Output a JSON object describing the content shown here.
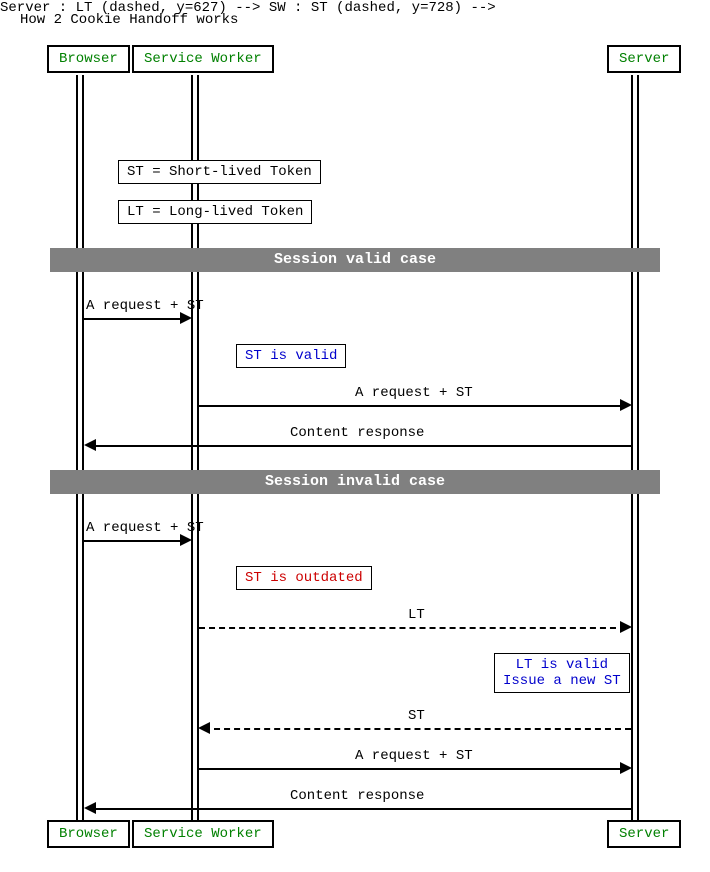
{
  "title": "How 2 Cookie Handoff works",
  "participants": {
    "browser": "Browser",
    "service_worker": "Service Worker",
    "server": "Server"
  },
  "notes": {
    "st_def": "ST = Short-lived Token",
    "lt_def": "LT = Long-lived Token",
    "st_valid": "ST is valid",
    "st_outdated": "ST is outdated",
    "lt_valid_l1": "LT is valid",
    "lt_valid_l2": "Issue a new ST"
  },
  "dividers": {
    "valid": "Session valid case",
    "invalid": "Session invalid case"
  },
  "messages": {
    "req_st": "A request + ST",
    "content": "Content response",
    "lt": "LT",
    "st": "ST"
  },
  "chart_data": {
    "type": "sequence",
    "title": "How 2 Cookie Handoff works",
    "participants": [
      "Browser",
      "Service Worker",
      "Server"
    ],
    "events": [
      {
        "kind": "note",
        "over": "Service Worker",
        "text": "ST = Short-lived Token"
      },
      {
        "kind": "note",
        "over": "Service Worker",
        "text": "LT = Long-lived Token"
      },
      {
        "kind": "divider",
        "text": "Session valid case"
      },
      {
        "kind": "message",
        "from": "Browser",
        "to": "Service Worker",
        "text": "A request + ST",
        "style": "solid"
      },
      {
        "kind": "note",
        "over": "Service Worker",
        "text": "ST is valid",
        "color": "blue"
      },
      {
        "kind": "message",
        "from": "Service Worker",
        "to": "Server",
        "text": "A request + ST",
        "style": "solid"
      },
      {
        "kind": "message",
        "from": "Server",
        "to": "Browser",
        "text": "Content response",
        "style": "solid"
      },
      {
        "kind": "divider",
        "text": "Session invalid case"
      },
      {
        "kind": "message",
        "from": "Browser",
        "to": "Service Worker",
        "text": "A request + ST",
        "style": "solid"
      },
      {
        "kind": "note",
        "over": "Service Worker",
        "text": "ST is outdated",
        "color": "red"
      },
      {
        "kind": "message",
        "from": "Service Worker",
        "to": "Server",
        "text": "LT",
        "style": "dashed"
      },
      {
        "kind": "note",
        "over": "Server",
        "text": "LT is valid\nIssue a new ST",
        "color": "blue"
      },
      {
        "kind": "message",
        "from": "Server",
        "to": "Service Worker",
        "text": "ST",
        "style": "dashed"
      },
      {
        "kind": "message",
        "from": "Service Worker",
        "to": "Server",
        "text": "A request + ST",
        "style": "solid"
      },
      {
        "kind": "message",
        "from": "Server",
        "to": "Browser",
        "text": "Content response",
        "style": "solid"
      }
    ]
  }
}
